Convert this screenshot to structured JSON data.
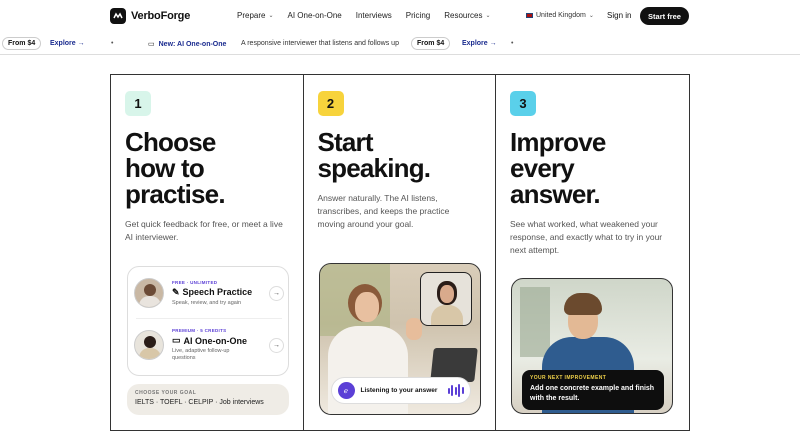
{
  "nav": {
    "brand": "VerboForge",
    "links": [
      {
        "label": "Prepare",
        "dropdown": true
      },
      {
        "label": "AI One-on-One",
        "dropdown": false
      },
      {
        "label": "Interviews",
        "dropdown": false
      },
      {
        "label": "Pricing",
        "dropdown": false
      },
      {
        "label": "Resources",
        "dropdown": true
      }
    ],
    "region": "United Kingdom",
    "sign_in": "Sign in",
    "start_free": "Start free"
  },
  "ticker": {
    "from_price_1": "From $4",
    "explore_1": "Explore",
    "new_label": "New: AI One-on-One",
    "new_desc": "A responsive interviewer that listens and follows up",
    "from_price_2": "From $4",
    "explore_2": "Explore"
  },
  "panels": [
    {
      "number": "1",
      "badge_color": "#d8f5ea",
      "headline": "Choose how to practise.",
      "description": "Get quick feedback for free, or meet a live AI interviewer."
    },
    {
      "number": "2",
      "badge_color": "#f7d33c",
      "headline": "Start speaking.",
      "description": "Answer naturally. The AI listens, transcribes, and keeps the practice moving around your goal."
    },
    {
      "number": "3",
      "badge_color": "#5ad0ea",
      "headline": "Improve every answer.",
      "description": "See what worked, what weakened your response, and exactly what to try in your next attempt."
    }
  ],
  "options": [
    {
      "tag": "FREE · UNLIMITED",
      "title": "Speech Practice",
      "subtitle": "Speak, review, and try again",
      "icon": "pen-icon"
    },
    {
      "tag": "PREMIUM · 5 CREDITS",
      "title": "AI One-on-One",
      "subtitle": "Live, adaptive follow-up questions",
      "icon": "video-icon"
    }
  ],
  "goal": {
    "label": "CHOOSE YOUR GOAL",
    "text": "IELTS · TOEFL · CELPIP · Job interviews"
  },
  "listening": {
    "text": "Listening to your answer"
  },
  "improvement": {
    "label": "YOUR NEXT IMPROVEMENT",
    "text": "Add one concrete example and finish with the result."
  },
  "colors": {
    "accent": "#5b3fd6",
    "link": "#1a2b8f",
    "dark": "#111111",
    "highlight": "#f1d24a"
  }
}
